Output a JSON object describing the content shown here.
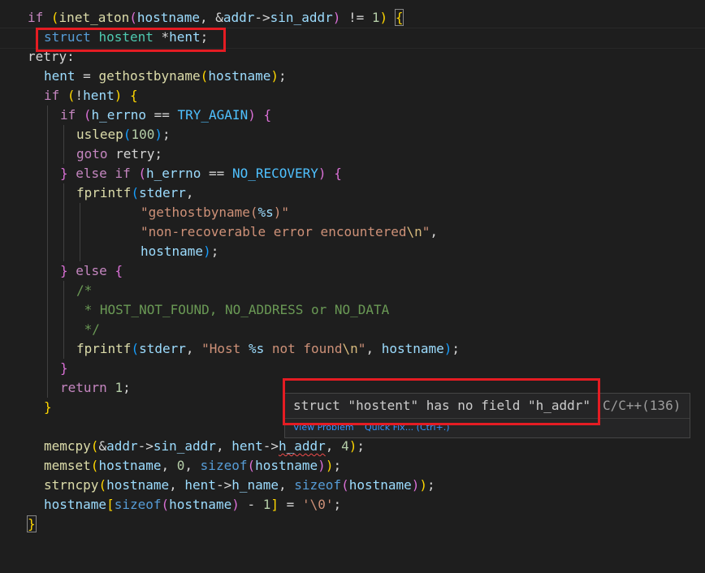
{
  "colors": {
    "background": "#1e1e1e",
    "highlight_box": "#e51c23",
    "error_squiggle": "#f14c4c",
    "link": "#3794ff"
  },
  "code": {
    "l1": {
      "if": "if",
      "p1": "(",
      "fn": "inet_aton",
      "p2": "(",
      "a1": "hostname",
      "p3": ", &",
      "a2": "addr",
      "arrow": "->",
      "a3": "sin_addr",
      "p4": ")",
      "p5": " != ",
      "num": "1",
      "p6": ")",
      "p7": " ",
      "br": "{"
    },
    "l2": {
      "kw": "struct",
      "type": "hostent",
      "rest": " *",
      "var": "hent",
      "semi": ";"
    },
    "l3": {
      "label": "retry:"
    },
    "l4": {
      "var": "hent",
      "eq": " = ",
      "fn": "gethostbyname",
      "p1": "(",
      "arg": "hostname",
      "p2": ")",
      "semi": ";"
    },
    "l5": {
      "if": "if",
      "p1": " (",
      "neg": "!",
      "var": "hent",
      "p2": ")",
      "sp": " ",
      "br": "{"
    },
    "l6": {
      "if": "if",
      "p1": " (",
      "var": "h_errno",
      "eq": " == ",
      "mac": "TRY_AGAIN",
      "p2": ")",
      "sp": " ",
      "br": "{"
    },
    "l7": {
      "fn": "usleep",
      "p1": "(",
      "num": "100",
      "p2": ")",
      "semi": ";"
    },
    "l8": {
      "kw": "goto",
      "label": " retry",
      "semi": ";"
    },
    "l9": {
      "br1": "}",
      "els": " else ",
      "if": "if",
      "p1": " (",
      "var": "h_errno",
      "eq": " == ",
      "mac": "NO_RECOVERY",
      "p2": ")",
      "sp": " ",
      "br2": "{"
    },
    "l10": {
      "fn": "fprintf",
      "p1": "(",
      "var": "stderr",
      "comma": ","
    },
    "l11": {
      "str1": "\"gethostbyname(",
      "fmt": "%s",
      "str2": ")\""
    },
    "l12": {
      "str1": "\"non-recoverable error encountered",
      "esc": "\\n",
      "str2": "\"",
      "comma": ","
    },
    "l13": {
      "var": "hostname",
      "p1": ")",
      "semi": ";"
    },
    "l14": {
      "br1": "}",
      "els": " else ",
      "br2": "{"
    },
    "l15": {
      "cm": "/*"
    },
    "l16": {
      "cm": " * HOST_NOT_FOUND, NO_ADDRESS or NO_DATA"
    },
    "l17": {
      "cm": " */"
    },
    "l18": {
      "fn": "fprintf",
      "p1": "(",
      "var": "stderr",
      "c1": ", ",
      "str1": "\"Host ",
      "fmt": "%s",
      "str2": " not found",
      "esc": "\\n",
      "str3": "\"",
      "c2": ", ",
      "var2": "hostname",
      "p2": ")",
      "semi": ";"
    },
    "l19": {
      "br": "}"
    },
    "l20": {
      "kw": "return",
      "sp": " ",
      "num": "1",
      "semi": ";"
    },
    "l21": {
      "br": "}"
    },
    "l23": {
      "fn": "memcpy",
      "p1": "(",
      "amp": "&",
      "v1": "addr",
      "arrow": "->",
      "v2": "sin_addr",
      "c1": ", ",
      "v3": "hent",
      "arrow2": "->",
      "v4": "h_addr",
      "c2": ", ",
      "num": "4",
      "p2": ")",
      "semi": ";"
    },
    "l24": {
      "fn": "memset",
      "p1": "(",
      "v1": "hostname",
      "c1": ", ",
      "num": "0",
      "c2": ", ",
      "kw": "sizeof",
      "p2": "(",
      "v2": "hostname",
      "p3": ")",
      "p4": ")",
      "semi": ";"
    },
    "l25": {
      "fn": "strncpy",
      "p1": "(",
      "v1": "hostname",
      "c1": ", ",
      "v2": "hent",
      "arrow": "->",
      "v3": "h_name",
      "c2": ", ",
      "kw": "sizeof",
      "p2": "(",
      "v4": "hostname",
      "p3": ")",
      "p4": ")",
      "semi": ";"
    },
    "l26": {
      "v1": "hostname",
      "b1": "[",
      "kw": "sizeof",
      "p1": "(",
      "v2": "hostname",
      "p2": ")",
      "op": " - ",
      "num": "1",
      "b2": "]",
      "eq": " = ",
      "str": "'\\0'",
      "semi": ";"
    },
    "l27": {
      "br": "}"
    }
  },
  "hover": {
    "message": "struct \"hostent\" has no field \"h_addr\"",
    "code": "C/C++(136)",
    "view_problem": "View Problem",
    "quick_fix": "Quick Fix... (Ctrl+.)"
  }
}
